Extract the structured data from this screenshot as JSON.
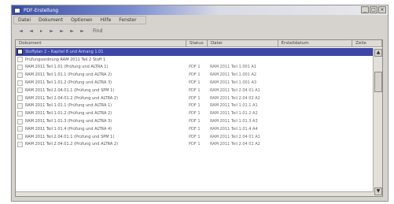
{
  "window": {
    "title": "PDF-Erstellung",
    "controls": {
      "minimize": "_",
      "maximize": "□",
      "close": "×"
    }
  },
  "menu": [
    "Datei",
    "Dokument",
    "Optionen",
    "Hilfe",
    "Fenster"
  ],
  "toolbar": {
    "buttons": [
      "first-icon",
      "back-icon",
      "prev-icon",
      "next-icon",
      "fast-forward-icon",
      "last-icon",
      "skip-icon"
    ],
    "find_label": "Find"
  },
  "columns": [
    "Dokument",
    "Status",
    "Datei",
    "Erstelldatum",
    "Zeile"
  ],
  "rows": [
    {
      "c1": "Stoffplan 2 – Kapitel 8 und Anhang 1.01",
      "c2": "",
      "c3": "",
      "selected": true
    },
    {
      "c1": "Prüfungsordnung RAM 2011 Teil 2 Stoff 1",
      "c2": "",
      "c3": "",
      "selected": false
    },
    {
      "c1": "RAM 2011 Teil 1.01 (Prüfung und ALTRA 1)",
      "c2": "PDF 1",
      "c3": "RAM 2011 Teil 1.001 A1",
      "selected": false
    },
    {
      "c1": "RAM 2011 Teil 1.01.1 (Prüfung und ALTRA 2)",
      "c2": "PDF 1",
      "c3": "RAM 2011 Teil 1.001 A2",
      "selected": false
    },
    {
      "c1": "RAM 2011 Teil 1.01.2 (Prüfung und ALTRA 3)",
      "c2": "PDF 1",
      "c3": "RAM 2011 Teil 1.001 A3",
      "selected": false
    },
    {
      "c1": "RAM 2011 Teil 2.04.01.1 (Prüfung und SPM 1)",
      "c2": "PDF 1",
      "c3": "RAM 2011 Teil 2.04 01 A1",
      "selected": false
    },
    {
      "c1": "RAM 2011 Teil 2.04.01.2 (Prüfung und ALTRA 2)",
      "c2": "PDF 1",
      "c3": "RAM 2011 Teil 2.04 02 A2",
      "selected": false
    },
    {
      "c1": "RAM 2011 Teil 1.01.1 (Prüfung und ALTRA 1)",
      "c2": "PDF 1",
      "c3": "RAM 2011 Teil 1.01.1 A1",
      "selected": false
    },
    {
      "c1": "RAM 2011 Teil 1.01.2 (Prüfung und ALTRA 2)",
      "c2": "PDF 1",
      "c3": "RAM 2011 Teil 1.01.2 A2",
      "selected": false
    },
    {
      "c1": "RAM 2011 Teil 1.01.3 (Prüfung und ALTRA 3)",
      "c2": "PDF 1",
      "c3": "RAM 2011 Teil 1.01.3 A3",
      "selected": false
    },
    {
      "c1": "RAM 2011 Teil 1.01.4 (Prüfung und ALTRA 4)",
      "c2": "PDF 1",
      "c3": "RAM 2011 Teil 1.01.4 A4",
      "selected": false
    },
    {
      "c1": "RAM 2011 Teil 2.04.01.1 (Prüfung und SPM 1)",
      "c2": "PDF 1",
      "c3": "RAM 2011 Teil 2.04 01 A1",
      "selected": false
    },
    {
      "c1": "RAM 2011 Teil 2.04.01.2 (Prüfung und ALTRA 2)",
      "c2": "PDF 1",
      "c3": "RAM 2011 Teil 2.04 02 A2",
      "selected": false
    }
  ],
  "colors": {
    "selection": "#3d46a6",
    "titlebar_start": "#3a4fa5"
  }
}
